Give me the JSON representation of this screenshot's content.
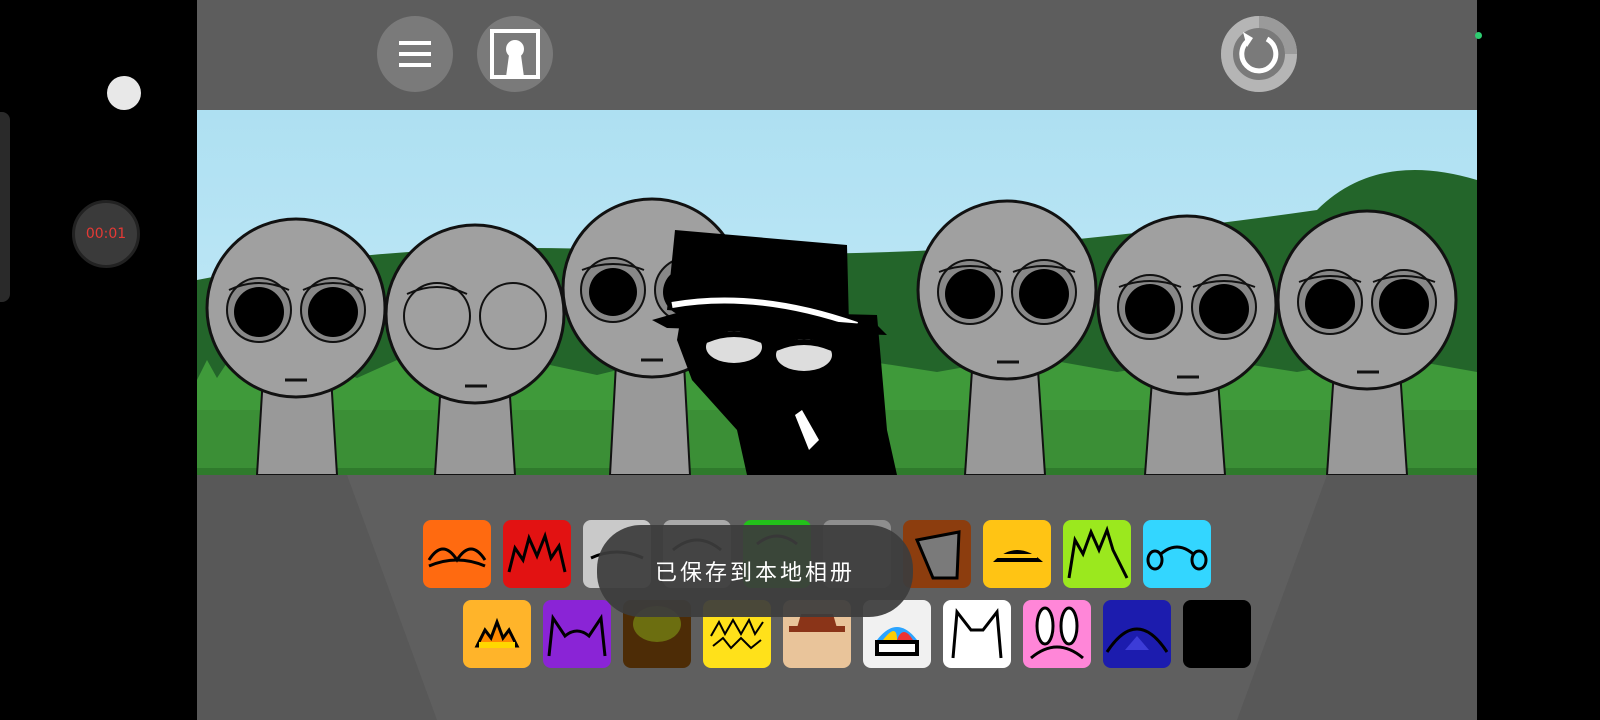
{
  "recording": {
    "timer": "00:01",
    "timer_color": "#e53935"
  },
  "toolbar": {
    "menu_icon": "hamburger-menu-icon",
    "portrait_icon": "portrait-icon",
    "reset_icon": "reset-icon"
  },
  "toast": {
    "message": "已保存到本地相册"
  },
  "characters": [
    {
      "eyes": "open-dark"
    },
    {
      "eyes": "empty"
    },
    {
      "eyes": "open-dark"
    },
    {
      "eyes": "hat-man-black"
    },
    {
      "eyes": "open-dark"
    },
    {
      "eyes": "open-dark"
    },
    {
      "eyes": "open-dark"
    }
  ],
  "palette": {
    "row1": [
      {
        "name": "orange-headband-icon",
        "color": "#ff6a10"
      },
      {
        "name": "red-spiky-icon",
        "color": "#e21212"
      },
      {
        "name": "gray-hat-icon",
        "color": "#c9c9c9"
      },
      {
        "name": "gray-wire-icon",
        "color": "#a9a9a9"
      },
      {
        "name": "green-leaf-icon",
        "color": "#22c21a"
      },
      {
        "name": "gray-mask-icon",
        "color": "#8e8e8e"
      },
      {
        "name": "bucket-icon",
        "color": "#8c3d0e"
      },
      {
        "name": "yellow-helmet-icon",
        "color": "#ffc414"
      },
      {
        "name": "lime-hair-icon",
        "color": "#9be81e"
      },
      {
        "name": "cyan-headphones-icon",
        "color": "#33d6ff"
      }
    ],
    "row2": [
      {
        "name": "sun-icon",
        "color": "#ffb42a"
      },
      {
        "name": "purple-horns-icon",
        "color": "#8a24d6"
      },
      {
        "name": "olive-bush-icon",
        "color": "#4d2c06"
      },
      {
        "name": "yellow-scribble-icon",
        "color": "#ffe11a"
      },
      {
        "name": "brown-hat-icon",
        "color": "#e9c49a"
      },
      {
        "name": "propeller-cap-icon",
        "color": "#f1f1f1"
      },
      {
        "name": "white-cat-icon",
        "color": "#ffffff"
      },
      {
        "name": "pink-bunny-icon",
        "color": "#ff86d8"
      },
      {
        "name": "blue-dome-icon",
        "color": "#1c1cae"
      },
      {
        "name": "black-blank-icon",
        "color": "#000000"
      }
    ]
  }
}
